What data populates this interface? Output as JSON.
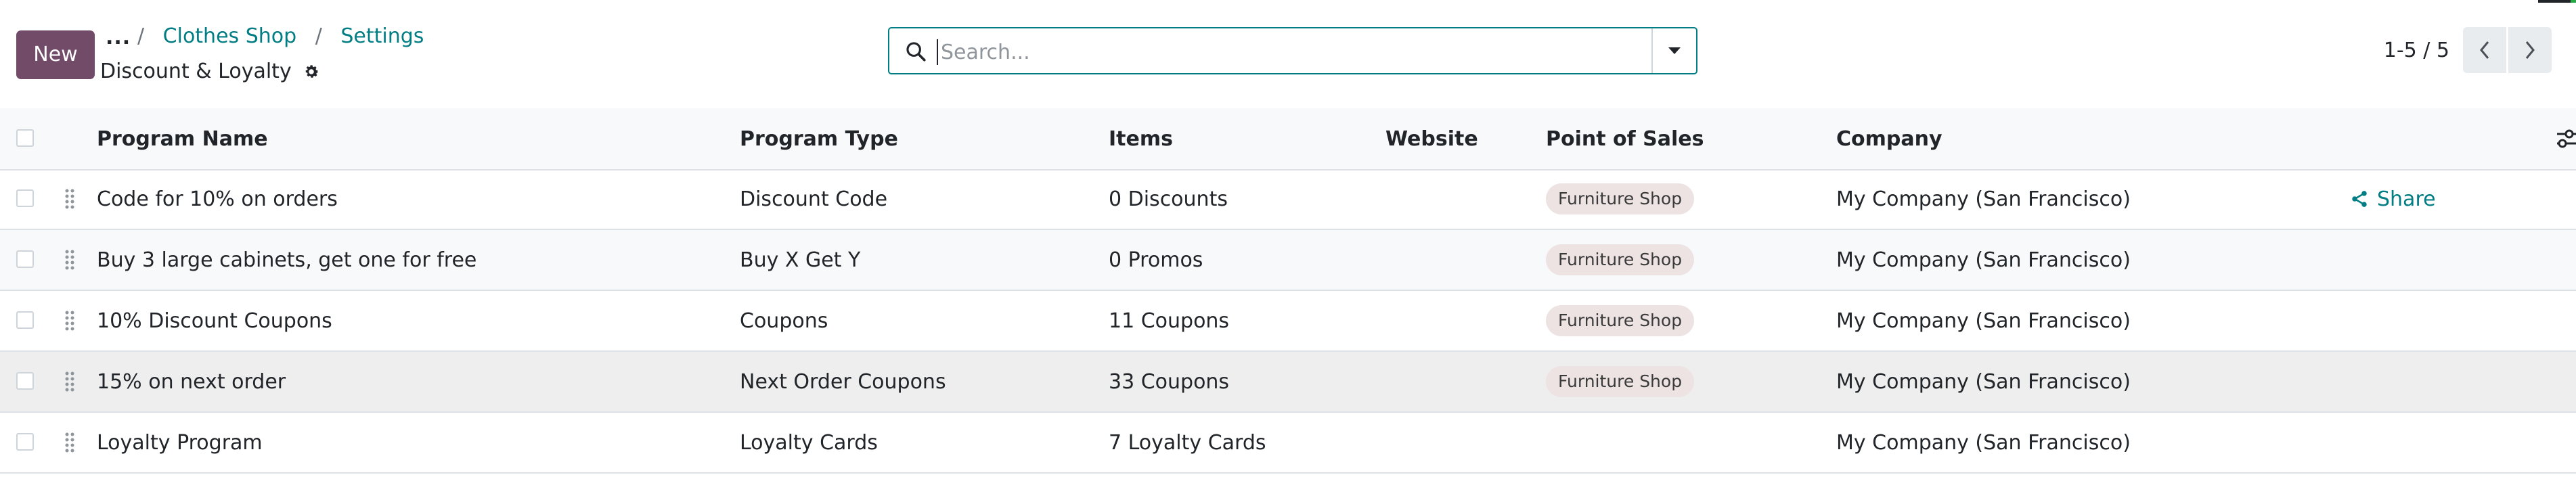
{
  "control_panel": {
    "new_label": "New",
    "more_label": "...",
    "breadcrumbs": [
      "Clothes Shop",
      "Settings"
    ],
    "title": "Discount & Loyalty",
    "search_placeholder": "Search...",
    "pager_value": "1-5 / 5"
  },
  "table": {
    "columns": [
      "Program Name",
      "Program Type",
      "Items",
      "Website",
      "Point of Sales",
      "Company"
    ],
    "rows": [
      {
        "name": "Code for 10% on orders",
        "type": "Discount Code",
        "items": "0 Discounts",
        "website": "",
        "pos": "Furniture Shop",
        "company": "My Company (San Francisco)",
        "action": "Share"
      },
      {
        "name": "Buy 3 large cabinets, get one for free",
        "type": "Buy X Get Y",
        "items": "0 Promos",
        "website": "",
        "pos": "Furniture Shop",
        "company": "My Company (San Francisco)",
        "action": ""
      },
      {
        "name": "10% Discount Coupons",
        "type": "Coupons",
        "items": "11 Coupons",
        "website": "",
        "pos": "Furniture Shop",
        "company": "My Company (San Francisco)",
        "action": ""
      },
      {
        "name": "15% on next order",
        "type": "Next Order Coupons",
        "items": "33 Coupons",
        "website": "",
        "pos": "Furniture Shop",
        "company": "My Company (San Francisco)",
        "action": ""
      },
      {
        "name": "Loyalty Program",
        "type": "Loyalty Cards",
        "items": "7 Loyalty Cards",
        "website": "",
        "pos": "",
        "company": "My Company (San Francisco)",
        "action": ""
      }
    ]
  },
  "icons": {
    "more": "ellipsis-icon",
    "settings": "gear-icon",
    "search": "search-icon",
    "toggle": "caret-down-icon",
    "prev": "chevron-left-icon",
    "next": "chevron-right-icon",
    "drag": "drag-handle-icon",
    "share": "share-icon",
    "columns": "optional-columns-icon"
  },
  "colors": {
    "primary": "#714b67",
    "link": "#017e84",
    "tag_bg": "#ede3e3"
  }
}
